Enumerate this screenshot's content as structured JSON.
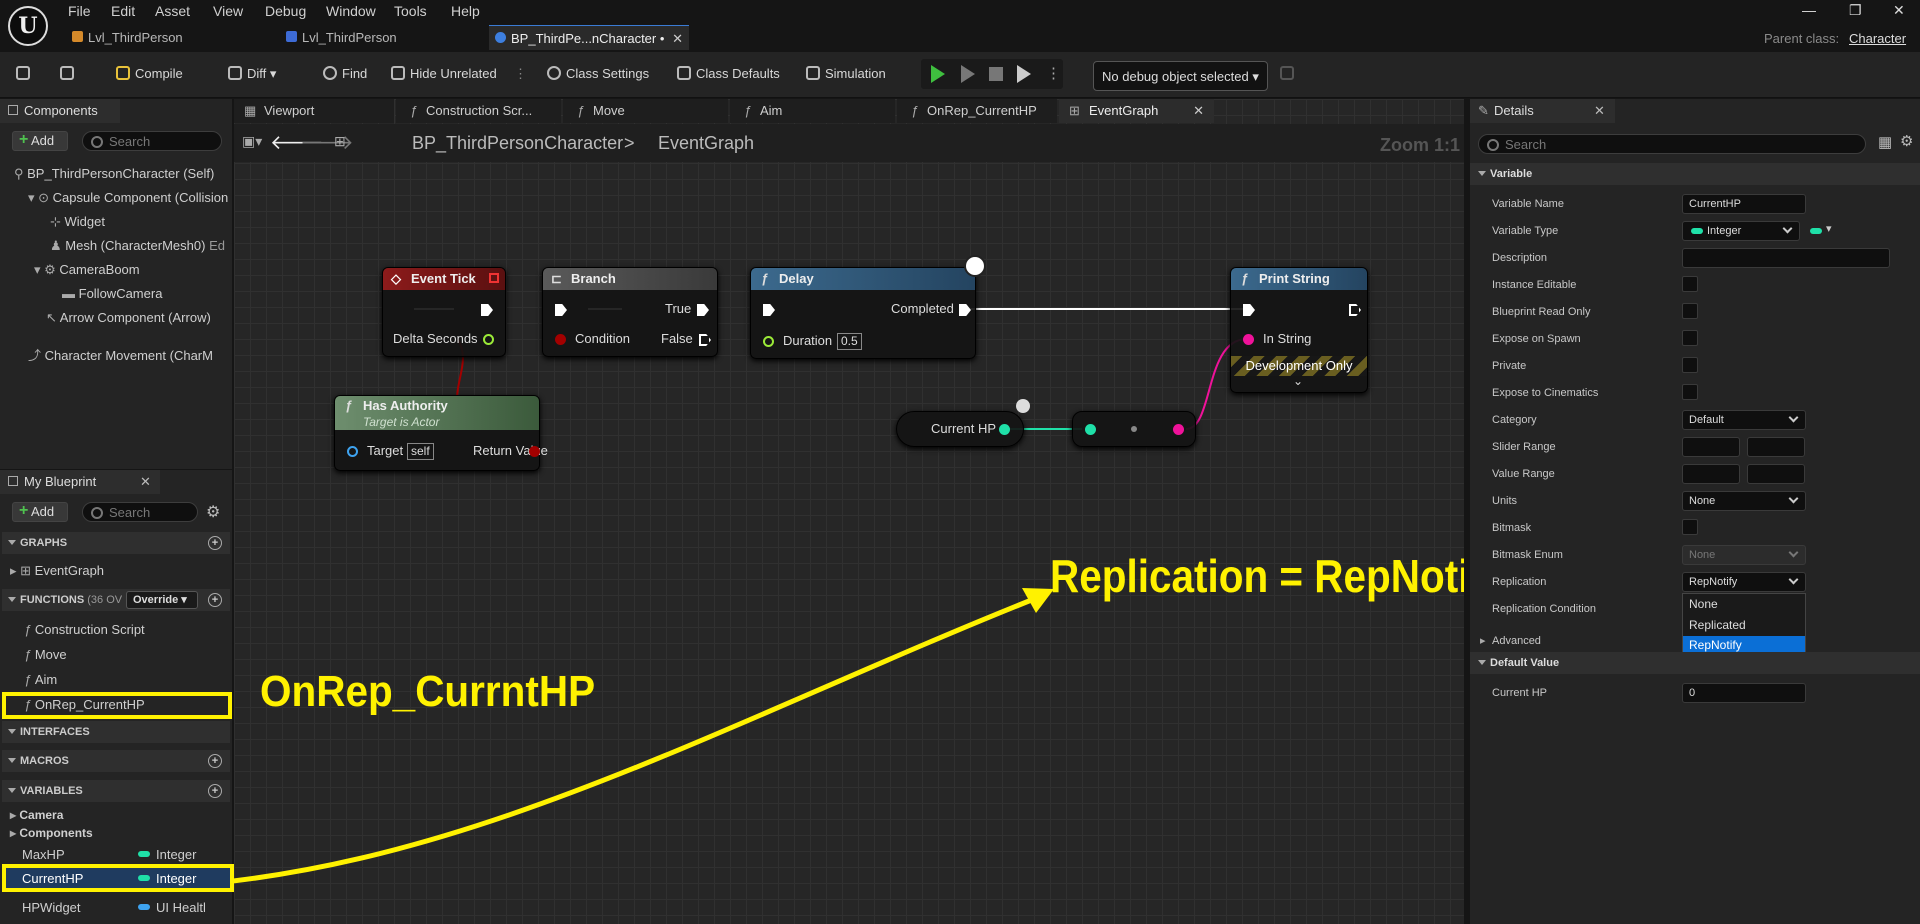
{
  "menu": [
    "File",
    "Edit",
    "Asset",
    "View",
    "Debug",
    "Window",
    "Tools",
    "Help"
  ],
  "tabs": [
    {
      "label": "Lvl_ThirdPerson"
    },
    {
      "label": "Lvl_ThirdPerson"
    },
    {
      "label": "BP_ThirdPe...nCharacter •"
    }
  ],
  "parent_class": {
    "label": "Parent class:",
    "value": "Character"
  },
  "toolbar": {
    "compile": "Compile",
    "diff": "Diff",
    "find": "Find",
    "hide_unrelated": "Hide Unrelated",
    "class_settings": "Class Settings",
    "class_defaults": "Class Defaults",
    "simulation": "Simulation",
    "debug_object": "No debug object selected"
  },
  "components": {
    "title": "Components",
    "add": "Add",
    "search_placeholder": "Search",
    "items": [
      "BP_ThirdPersonCharacter (Self)",
      "Capsule Component (Collision",
      "Widget",
      "Mesh (CharacterMesh0)",
      "CameraBoom",
      "FollowCamera",
      "Arrow Component (Arrow)",
      "Character Movement (CharM"
    ],
    "mesh_suffix": "Ed"
  },
  "my_blueprint": {
    "title": "My Blueprint",
    "add": "Add",
    "search_placeholder": "Search",
    "graphs_label": "GRAPHS",
    "event_graph": "EventGraph",
    "functions_label": "FUNCTIONS",
    "functions_count": "(36 OV",
    "override": "Override",
    "functions": [
      "Construction Script",
      "Move",
      "Aim",
      "OnRep_CurrentHP"
    ],
    "interfaces": "INTERFACES",
    "macros": "MACROS",
    "variables": "VARIABLES",
    "categories": [
      "Camera",
      "Components"
    ],
    "vars": [
      {
        "name": "MaxHP",
        "type": "Integer"
      },
      {
        "name": "CurrentHP",
        "type": "Integer"
      },
      {
        "name": "HPWidget",
        "type": "UI Healtl"
      }
    ]
  },
  "graph": {
    "tabs": [
      "Viewport",
      "Construction Scr...",
      "Move",
      "Aim",
      "OnRep_CurrentHP",
      "EventGraph"
    ],
    "breadcrumb_root": "BP_ThirdPersonCharacter",
    "breadcrumb_sep": ">",
    "breadcrumb_leaf": "EventGraph",
    "zoom": "Zoom 1:1",
    "nodes": {
      "event_tick": {
        "title": "Event Tick",
        "pin": "Delta Seconds"
      },
      "branch": {
        "title": "Branch",
        "true": "True",
        "false": "False",
        "condition": "Condition"
      },
      "delay": {
        "title": "Delay",
        "completed": "Completed",
        "duration": "Duration",
        "duration_value": "0.5"
      },
      "print_string": {
        "title": "Print String",
        "in_string": "In String",
        "dev_only": "Development Only"
      },
      "has_authority": {
        "title": "Has Authority",
        "subtitle": "Target is Actor",
        "target": "Target",
        "target_value": "self",
        "return": "Return Value"
      },
      "current_hp": {
        "label": "Current HP"
      }
    }
  },
  "details": {
    "title": "Details",
    "search_placeholder": "Search",
    "section_variable": "Variable",
    "rows": [
      {
        "label": "Variable Name",
        "value": "CurrentHP"
      },
      {
        "label": "Variable Type",
        "value": "Integer"
      },
      {
        "label": "Description",
        "value": ""
      },
      {
        "label": "Instance Editable"
      },
      {
        "label": "Blueprint Read Only"
      },
      {
        "label": "Expose on Spawn"
      },
      {
        "label": "Private"
      },
      {
        "label": "Expose to Cinematics"
      },
      {
        "label": "Category",
        "value": "Default"
      },
      {
        "label": "Slider Range"
      },
      {
        "label": "Value Range"
      },
      {
        "label": "Units",
        "value": "None"
      },
      {
        "label": "Bitmask"
      },
      {
        "label": "Bitmask Enum",
        "value": "None"
      },
      {
        "label": "Replication",
        "value": "RepNotify"
      },
      {
        "label": "Replication Condition"
      }
    ],
    "dropdown_options": [
      "None",
      "Replicated",
      "RepNotify"
    ],
    "advanced": "Advanced",
    "section_default": "Default Value",
    "default_label": "Current HP",
    "default_value": "0"
  },
  "annotations": {
    "onrep_text": "OnRep_CurrntHP",
    "replication_text": "Replication = RepNotify"
  },
  "colors": {
    "accent_yellow": "#fff200",
    "integer_pin": "#1fe0a8",
    "string_pin": "#f0129a",
    "bool_pin": "#a30000",
    "selected_blue": "#0b6fd6"
  }
}
